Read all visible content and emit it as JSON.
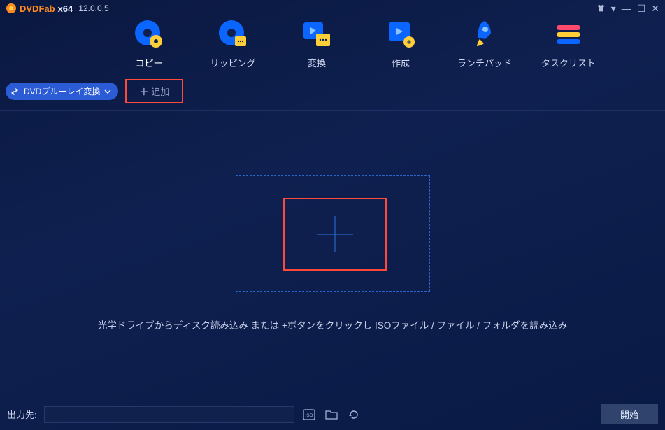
{
  "titlebar": {
    "brand_prefix": "DVDFab",
    "brand_arch": "x64",
    "version": "12.0.0.5"
  },
  "tabs": {
    "copy": "コピー",
    "ripping": "リッピング",
    "convert": "変換",
    "create": "作成",
    "launchpad": "ランチパッド",
    "tasklist": "タスクリスト"
  },
  "subbar": {
    "mode_label": "DVDブルーレイ変換",
    "add_label": "追加"
  },
  "stage": {
    "hint": "光学ドライブからディスク読み込み または +ボタンをクリックし ISOファイル / ファイル / フォルダを読み込み"
  },
  "bottom": {
    "output_label": "出力先:",
    "start_label": "開始"
  }
}
